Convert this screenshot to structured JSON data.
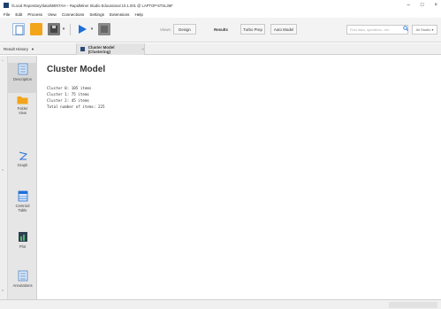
{
  "window": {
    "title": "//Local Repository/data/MENTAH – RapidMiner Studio Educational 10.1.001 @ LAPTOP-5TSL36F",
    "minimize": "–",
    "maximize": "□",
    "close": "×"
  },
  "menu": [
    "File",
    "Edit",
    "Process",
    "View",
    "Connections",
    "Settings",
    "Extensions",
    "Help"
  ],
  "toolbar": {
    "views_label": "Views:",
    "view_tabs": [
      "Design",
      "Results",
      "Turbo Prep",
      "Auto Model"
    ],
    "active_view": "Results",
    "search_placeholder": "Find data, operators...etc",
    "studio_button": "All Studio ▾"
  },
  "tabs": {
    "result_history": "Result History",
    "result_history_arrow": "▼",
    "cluster_tab": "Cluster Model (Clustering)",
    "cluster_close": "×"
  },
  "sidebar": {
    "items": [
      {
        "label": "Description",
        "icon": "description-icon"
      },
      {
        "label": "Folder View",
        "icon": "folder-icon"
      },
      {
        "label": "Graph",
        "icon": "graph-icon"
      },
      {
        "label": "Centroid Table",
        "icon": "table-icon"
      },
      {
        "label": "Plot",
        "icon": "plot-icon"
      },
      {
        "label": "Annotations",
        "icon": "annotations-icon"
      }
    ]
  },
  "main": {
    "title": "Cluster Model",
    "lines": [
      "Cluster 0: 105 items",
      "Cluster 1: 75 items",
      "Cluster 2: 45 items",
      "Total number of items: 225"
    ]
  },
  "colors": {
    "accent_blue": "#1e6fd9",
    "folder_orange": "#f2a51a",
    "dark_navy": "#2a4a78"
  }
}
